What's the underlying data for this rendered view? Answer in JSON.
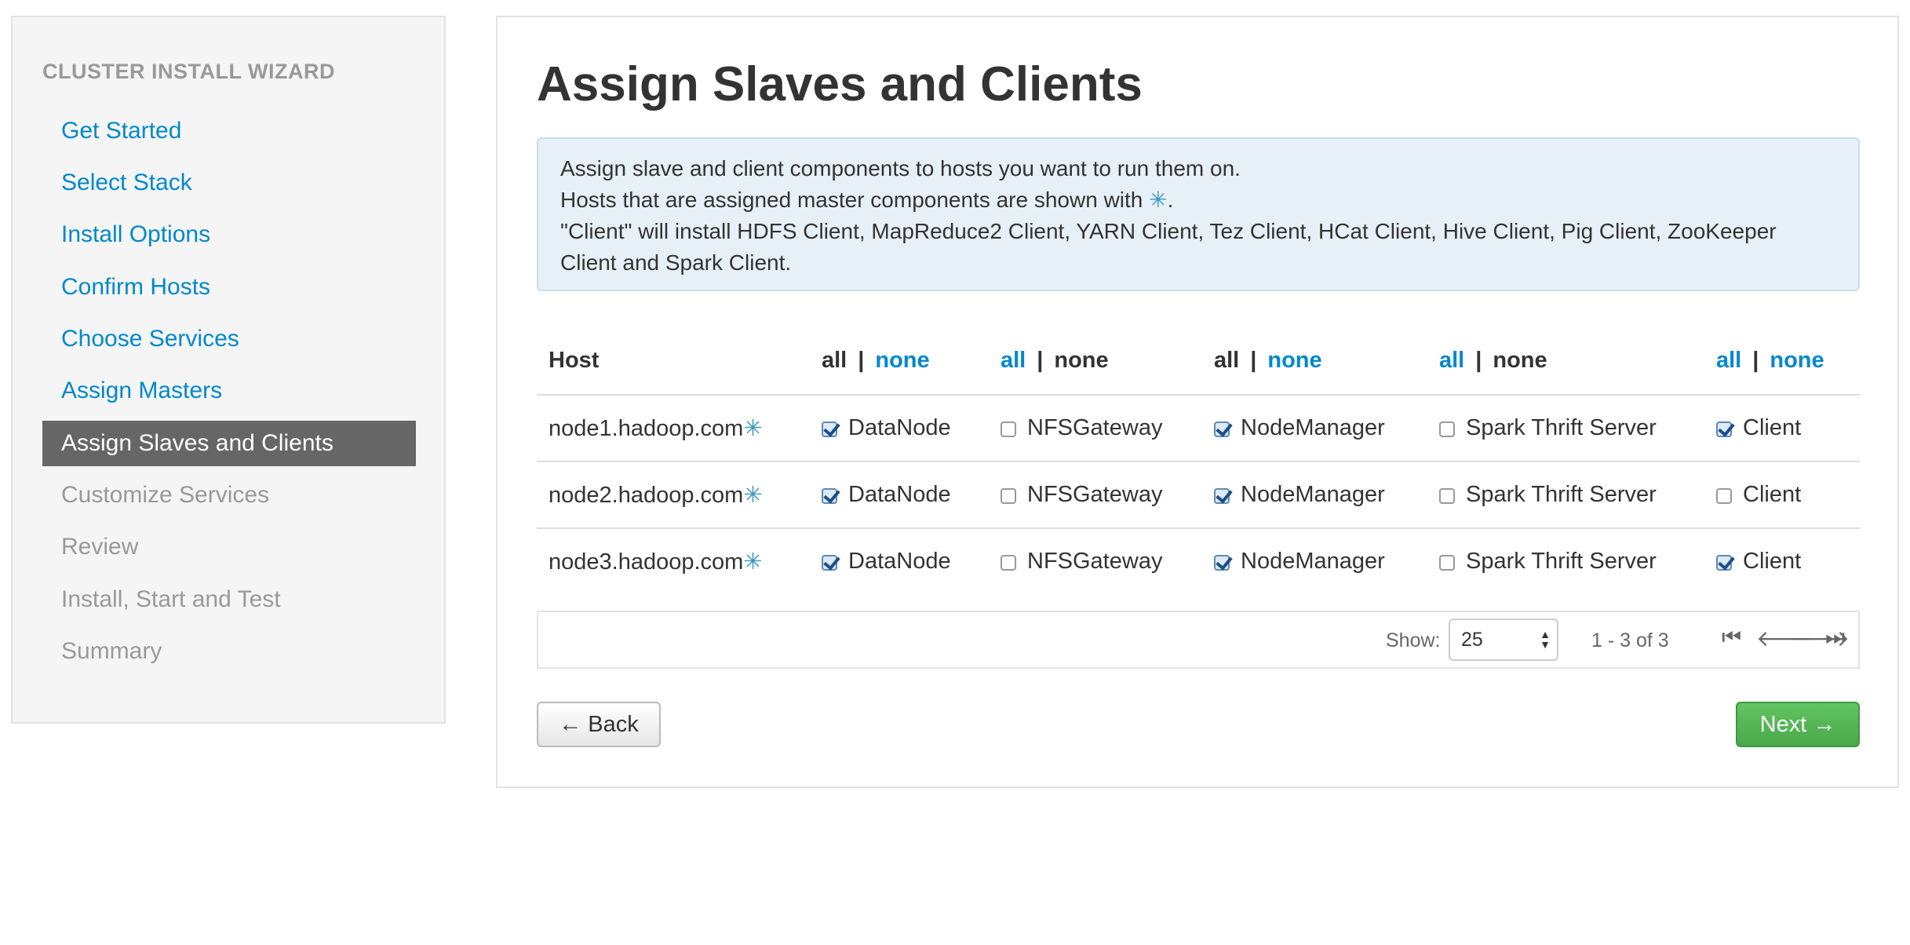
{
  "sidebar": {
    "header": "CLUSTER INSTALL WIZARD",
    "items": [
      {
        "label": "Get Started",
        "state": "done"
      },
      {
        "label": "Select Stack",
        "state": "done"
      },
      {
        "label": "Install Options",
        "state": "done"
      },
      {
        "label": "Confirm Hosts",
        "state": "done"
      },
      {
        "label": "Choose Services",
        "state": "done"
      },
      {
        "label": "Assign Masters",
        "state": "done"
      },
      {
        "label": "Assign Slaves and Clients",
        "state": "active"
      },
      {
        "label": "Customize Services",
        "state": "todo"
      },
      {
        "label": "Review",
        "state": "todo"
      },
      {
        "label": "Install, Start and Test",
        "state": "todo"
      },
      {
        "label": "Summary",
        "state": "todo"
      }
    ]
  },
  "main": {
    "title": "Assign Slaves and Clients",
    "info": {
      "line1": "Assign slave and client components to hosts you want to run them on.",
      "line2_prefix": "Hosts that are assigned master components are shown with",
      "line2_suffix": ".",
      "line3": "\"Client\" will install HDFS Client, MapReduce2 Client, YARN Client, Tez Client, HCat Client, Hive Client, Pig Client, ZooKeeper Client and Spark Client."
    },
    "master_marker": "✳",
    "table": {
      "host_header": "Host",
      "all_label": "all",
      "none_label": "none",
      "column_links": [
        {
          "all": "plain",
          "none": "link"
        },
        {
          "all": "link",
          "none": "plain"
        },
        {
          "all": "plain",
          "none": "link"
        },
        {
          "all": "link",
          "none": "plain"
        },
        {
          "all": "link",
          "none": "link"
        }
      ],
      "components": [
        "DataNode",
        "NFSGateway",
        "NodeManager",
        "Spark Thrift Server",
        "Client"
      ],
      "rows": [
        {
          "host": "node1.hadoop.com",
          "checked": [
            true,
            false,
            true,
            false,
            true
          ]
        },
        {
          "host": "node2.hadoop.com",
          "checked": [
            true,
            false,
            true,
            false,
            false
          ]
        },
        {
          "host": "node3.hadoop.com",
          "checked": [
            true,
            false,
            true,
            false,
            true
          ]
        }
      ]
    },
    "pager": {
      "show_label": "Show:",
      "page_size": "25",
      "range": "1 - 3 of 3"
    },
    "back_label": "← Back",
    "next_label": "Next →"
  },
  "colors": {
    "link": "#0088cc",
    "active_nav": "#666666",
    "next_button": "#4aa84a",
    "master_marker": "#3399bb"
  }
}
